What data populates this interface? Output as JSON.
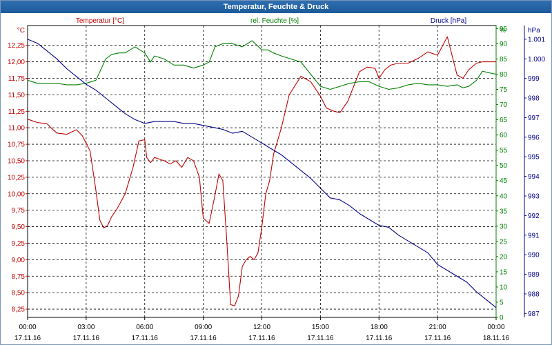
{
  "window": {
    "title": "Temperatur, Feuchte & Druck"
  },
  "colors": {
    "temperature": "#c00000",
    "humidity": "#008000",
    "pressure": "#00008b",
    "title_bar": "#1f5fa0"
  },
  "chart_data": {
    "type": "line",
    "title": "Temperatur, Feuchte & Druck",
    "grid": true,
    "x_ticks": [
      {
        "time": "00:00",
        "date": "17.11.16"
      },
      {
        "time": "03:00",
        "date": "17.11.16"
      },
      {
        "time": "06:00",
        "date": "17.11.16"
      },
      {
        "time": "09:00",
        "date": "17.11.16"
      },
      {
        "time": "12:00",
        "date": "17.11.16"
      },
      {
        "time": "15:00",
        "date": "17.11.16"
      },
      {
        "time": "18:00",
        "date": "17.11.16"
      },
      {
        "time": "21:00",
        "date": "17.11.16"
      },
      {
        "time": "00:00",
        "date": "18.11.16"
      }
    ],
    "xlim_hours": [
      0,
      24
    ],
    "axes": {
      "temperature": {
        "unit": "°C",
        "label": "Temperatur [°C]",
        "ylim": [
          8.125,
          12.55
        ],
        "ticks": [
          "8,25",
          "8,50",
          "8,75",
          "9,00",
          "9,25",
          "9,50",
          "9,75",
          "10,00",
          "10,25",
          "10,50",
          "10,75",
          "11,00",
          "11,25",
          "11,50",
          "11,75",
          "12,00",
          "12,25"
        ]
      },
      "humidity": {
        "unit": "%",
        "label": "rel. Feuchte [%]",
        "ylim": [
          0,
          96
        ],
        "ticks": [
          "0",
          "5",
          "10",
          "15",
          "20",
          "25",
          "30",
          "35",
          "40",
          "45",
          "50",
          "55",
          "60",
          "65",
          "70",
          "75",
          "80",
          "85",
          "90",
          "95"
        ]
      },
      "pressure": {
        "unit": "hPa",
        "label": "Druck [hPa]",
        "ylim": [
          986.8,
          1001.7
        ],
        "ticks": [
          "987",
          "988",
          "989",
          "990",
          "991",
          "992",
          "993",
          "994",
          "995",
          "996",
          "997",
          "998",
          "999",
          "1.000",
          "1.001"
        ]
      }
    },
    "series": [
      {
        "name": "Temperatur [°C]",
        "axis": "temperature",
        "x": [
          0,
          0.5,
          1,
          1.2,
          1.5,
          2,
          2.5,
          2.8,
          3.2,
          3.5,
          3.7,
          3.9,
          4.1,
          4.3,
          4.6,
          5,
          5.4,
          5.7,
          6,
          6.1,
          6.3,
          6.5,
          6.8,
          7,
          7.3,
          7.6,
          7.9,
          8.2,
          8.5,
          8.8,
          9,
          9.3,
          9.6,
          9.8,
          10,
          10.2,
          10.4,
          10.6,
          10.8,
          11,
          11.2,
          11.4,
          11.6,
          11.8,
          12,
          12.2,
          12.4,
          12.6,
          13,
          13.4,
          14,
          14.5,
          15,
          15.3,
          15.7,
          16,
          16.4,
          17,
          17.4,
          17.8,
          18,
          18.3,
          18.6,
          19,
          19.5,
          20,
          20.5,
          21,
          21.5,
          22,
          22.3,
          22.6,
          23,
          23.3,
          23.6,
          24
        ],
        "values": [
          11.13,
          11.08,
          11.06,
          11.0,
          10.92,
          10.9,
          10.97,
          10.88,
          10.65,
          10.05,
          9.6,
          9.48,
          9.52,
          9.65,
          9.78,
          10.0,
          10.4,
          10.8,
          10.82,
          10.55,
          10.47,
          10.55,
          10.52,
          10.5,
          10.45,
          10.5,
          10.4,
          10.55,
          10.5,
          10.25,
          9.63,
          9.55,
          9.98,
          10.3,
          10.2,
          9.3,
          8.32,
          8.3,
          8.45,
          8.9,
          9.0,
          9.05,
          9.0,
          9.1,
          9.5,
          10.0,
          10.2,
          10.6,
          11.0,
          11.5,
          11.78,
          11.7,
          11.48,
          11.3,
          11.25,
          11.23,
          11.4,
          11.85,
          11.92,
          11.9,
          11.75,
          11.88,
          11.95,
          11.98,
          11.98,
          12.05,
          12.15,
          12.1,
          12.38,
          11.8,
          11.75,
          11.88,
          11.98,
          12.0,
          12.0,
          12.0
        ]
      },
      {
        "name": "rel. Feuchte [%]",
        "axis": "humidity",
        "x": [
          0,
          0.5,
          1,
          1.5,
          2,
          2.5,
          3,
          3.5,
          4,
          4.3,
          4.7,
          5,
          5.5,
          6,
          6.3,
          6.5,
          7,
          7.5,
          8,
          8.5,
          9,
          9.3,
          9.6,
          10,
          10.5,
          11,
          11.5,
          12,
          12.3,
          12.6,
          13,
          13.5,
          14,
          14.5,
          15,
          15.5,
          16,
          16.5,
          17,
          17.5,
          18,
          18.5,
          19,
          19.5,
          20,
          20.5,
          21,
          21.5,
          22,
          22.3,
          22.6,
          23,
          23.3,
          23.6,
          24
        ],
        "values": [
          78,
          77,
          77,
          77,
          76.5,
          76.5,
          77,
          78,
          85,
          86.5,
          87,
          87,
          89,
          87,
          84,
          86,
          85,
          83,
          83,
          82,
          83,
          84,
          89,
          90,
          90,
          89,
          91,
          88,
          88,
          87,
          86,
          85,
          84,
          80,
          76,
          75,
          76,
          77,
          77.5,
          77.5,
          76,
          75,
          75.5,
          76.5,
          77,
          76.5,
          76.5,
          76,
          76.5,
          75.5,
          76,
          78,
          81,
          80.5,
          80
        ]
      },
      {
        "name": "Druck [hPa]",
        "axis": "pressure",
        "x": [
          0,
          0.5,
          1,
          1.5,
          2,
          2.5,
          3,
          3.5,
          4,
          4.5,
          5,
          5.5,
          6,
          6.5,
          7,
          7.5,
          8,
          8.5,
          9,
          9.5,
          10,
          10.5,
          11,
          11.5,
          12,
          12.5,
          13,
          13.5,
          14,
          14.5,
          15,
          15.5,
          16,
          16.5,
          17,
          17.5,
          18,
          18.5,
          19,
          19.5,
          20,
          20.5,
          21,
          21.5,
          22,
          22.5,
          23,
          23.5,
          24
        ],
        "values": [
          1001.0,
          1000.8,
          1000.4,
          1000.0,
          999.5,
          999.1,
          998.7,
          998.4,
          998.0,
          997.6,
          997.2,
          996.9,
          996.7,
          996.8,
          996.8,
          996.8,
          996.7,
          996.7,
          996.6,
          996.5,
          996.4,
          996.2,
          996.3,
          996.0,
          995.7,
          995.4,
          995.1,
          994.7,
          994.3,
          993.9,
          993.4,
          992.9,
          992.8,
          992.5,
          992.1,
          991.8,
          991.5,
          991.4,
          991.0,
          990.7,
          990.4,
          990.1,
          989.5,
          989.2,
          988.9,
          988.6,
          988.1,
          987.7,
          987.3
        ]
      }
    ]
  }
}
